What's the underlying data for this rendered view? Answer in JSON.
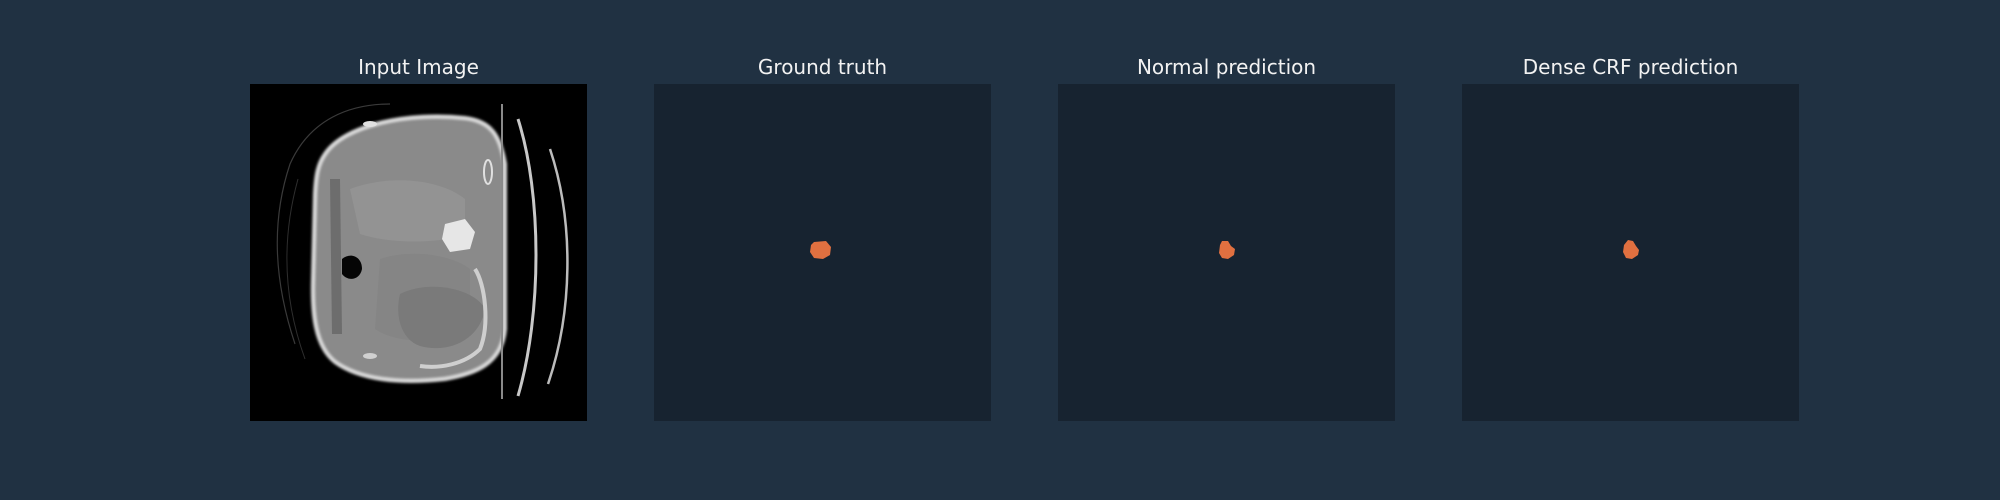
{
  "panels": [
    {
      "title": "Input Image",
      "content": "ct-axial-slice"
    },
    {
      "title": "Ground truth",
      "content": "segmentation-mask"
    },
    {
      "title": "Normal prediction",
      "content": "segmentation-mask"
    },
    {
      "title": "Dense CRF prediction",
      "content": "segmentation-mask"
    }
  ],
  "colors": {
    "background": "#203142",
    "mask_background": "#172330",
    "lesion": "#E07040",
    "title_text": "#f2f2f2"
  }
}
